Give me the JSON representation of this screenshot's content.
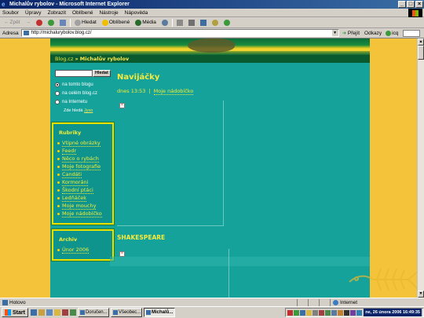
{
  "window": {
    "title": "Michalův rybolov - Microsoft Internet Explorer",
    "controls": [
      "_",
      "□",
      "×"
    ]
  },
  "menu": [
    "Soubor",
    "Úpravy",
    "Zobrazit",
    "Oblíbené",
    "Nástroje",
    "Nápověda"
  ],
  "toolbar": {
    "back": "Zpět",
    "forward": "→",
    "search": "Hledat",
    "favorites": "Oblíbené",
    "media": "Média"
  },
  "address": {
    "label": "Adresa",
    "url": "http://michalurybolov.blog.cz/",
    "go": "Přejít",
    "links": "Odkazy",
    "icq": "icq"
  },
  "blog": {
    "breadcrumb_site": "Blog.cz",
    "breadcrumb_sep": "»",
    "breadcrumb_blog": "Michalův rybolov",
    "search_button": "Hledat",
    "radio_options": [
      {
        "label": "na tomto blogu",
        "selected": true
      },
      {
        "label": "na celém blog.cz",
        "selected": false
      },
      {
        "label": "na Internetu",
        "selected": false
      }
    ],
    "hint_prefix": "Zde hledá",
    "hint_link": "Jyxo",
    "rubriky_title": "Rubriky",
    "rubriky": [
      "Vtipné obrázky",
      "Feedr",
      "Něco o rybách",
      "Moje fotografie",
      "Candáti",
      "Kormoráni",
      "Škodní ptáci",
      "Ledňáček",
      "Moje mouchy",
      "Moje nádobíčko"
    ],
    "archiv_title": "Archiv",
    "archiv": [
      "Únor 2006"
    ],
    "post_title": "Navijáčky",
    "post_time": "dnes 13:53",
    "post_sep": "|",
    "post_category": "Moje nádobíčko",
    "section_title": "SHAKESPEARE"
  },
  "status": {
    "text": "Hotovo",
    "zone": "Internet"
  },
  "taskbar": {
    "start": "Start",
    "tasks": [
      {
        "label": "Doručen...",
        "active": false
      },
      {
        "label": "Všeobec...",
        "active": false
      },
      {
        "label": "Michalů...",
        "active": true
      }
    ],
    "clock": "ne, 26 února 2006  16:49:35"
  }
}
